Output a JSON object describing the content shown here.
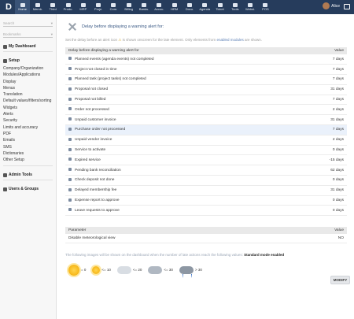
{
  "topbar": {
    "logo": "D",
    "menu": [
      "Home",
      "Memb.",
      "Third",
      "Produ.",
      "MRP",
      "Proje.",
      "Com.",
      "Billing",
      "Banks.",
      "Accou.",
      "HRM",
      "Docu.",
      "Agenda",
      "Ticket",
      "Tools",
      "Websi.",
      "POS"
    ],
    "active_index": 0,
    "user_name": "Alice"
  },
  "sidebar": {
    "search_placeholder": "Search",
    "bookmarks_placeholder": "Bookmarks",
    "my_dashboard": "My Dashboard",
    "setup_title": "Setup",
    "setup_items": [
      "Company/Organization",
      "Modules/Applications",
      "Display",
      "Menus",
      "Translation",
      "Default values/filters/sorting",
      "Widgets",
      "Alerts",
      "Security",
      "Limits and accuracy",
      "PDF",
      "Emails",
      "SMS",
      "Dictionaries",
      "Other Setup"
    ],
    "admin_tools": "Admin Tools",
    "users_groups": "Users & Groups"
  },
  "main": {
    "title": "Delay before displaying a warning alert for:",
    "description_part1": "Set the delay before an alert icon",
    "description_part2": "is shown onscreen for the late element. Only elements from",
    "description_link": "enabled modules",
    "description_part3": "are shown.",
    "table1": {
      "col1": "Delay before displaying a warning alert for",
      "col2": "Value",
      "rows": [
        {
          "label": "Planned events (agenda events) not completed",
          "value": "7 days"
        },
        {
          "label": "Project not closed in time",
          "value": "7 days"
        },
        {
          "label": "Planned task (project tasks) not completed",
          "value": "7 days"
        },
        {
          "label": "Proposal not closed",
          "value": "31 days"
        },
        {
          "label": "Proposal not billed",
          "value": "7 days"
        },
        {
          "label": "Order not processed",
          "value": "2 days"
        },
        {
          "label": "Unpaid customer invoice",
          "value": "31 days"
        },
        {
          "label": "Purchase order not processed",
          "value": "7 days"
        },
        {
          "label": "Unpaid vendor invoice",
          "value": "2 days"
        },
        {
          "label": "Service to activate",
          "value": "0 days"
        },
        {
          "label": "Expired service",
          "value": "-15 days"
        },
        {
          "label": "Pending bank reconciliation",
          "value": "62 days"
        },
        {
          "label": "Check deposit not done",
          "value": "0 days"
        },
        {
          "label": "Delayed membership fee",
          "value": "31 days"
        },
        {
          "label": "Expense report to approve",
          "value": "0 days"
        },
        {
          "label": "Leave requests to approve",
          "value": "0 days"
        }
      ]
    },
    "table2": {
      "col1": "Parameter",
      "col2": "Value",
      "row_label": "Disable meteorological view",
      "row_value": "NO"
    },
    "note": "The following images will be shown on the dashboard when the number of late actions reach the following values:",
    "note_mode": "Standard mode enabled",
    "weather": [
      "= 0",
      "<= 10",
      "<= 20",
      "<= 30",
      "> 30"
    ],
    "modify_button": "MODIFY"
  }
}
